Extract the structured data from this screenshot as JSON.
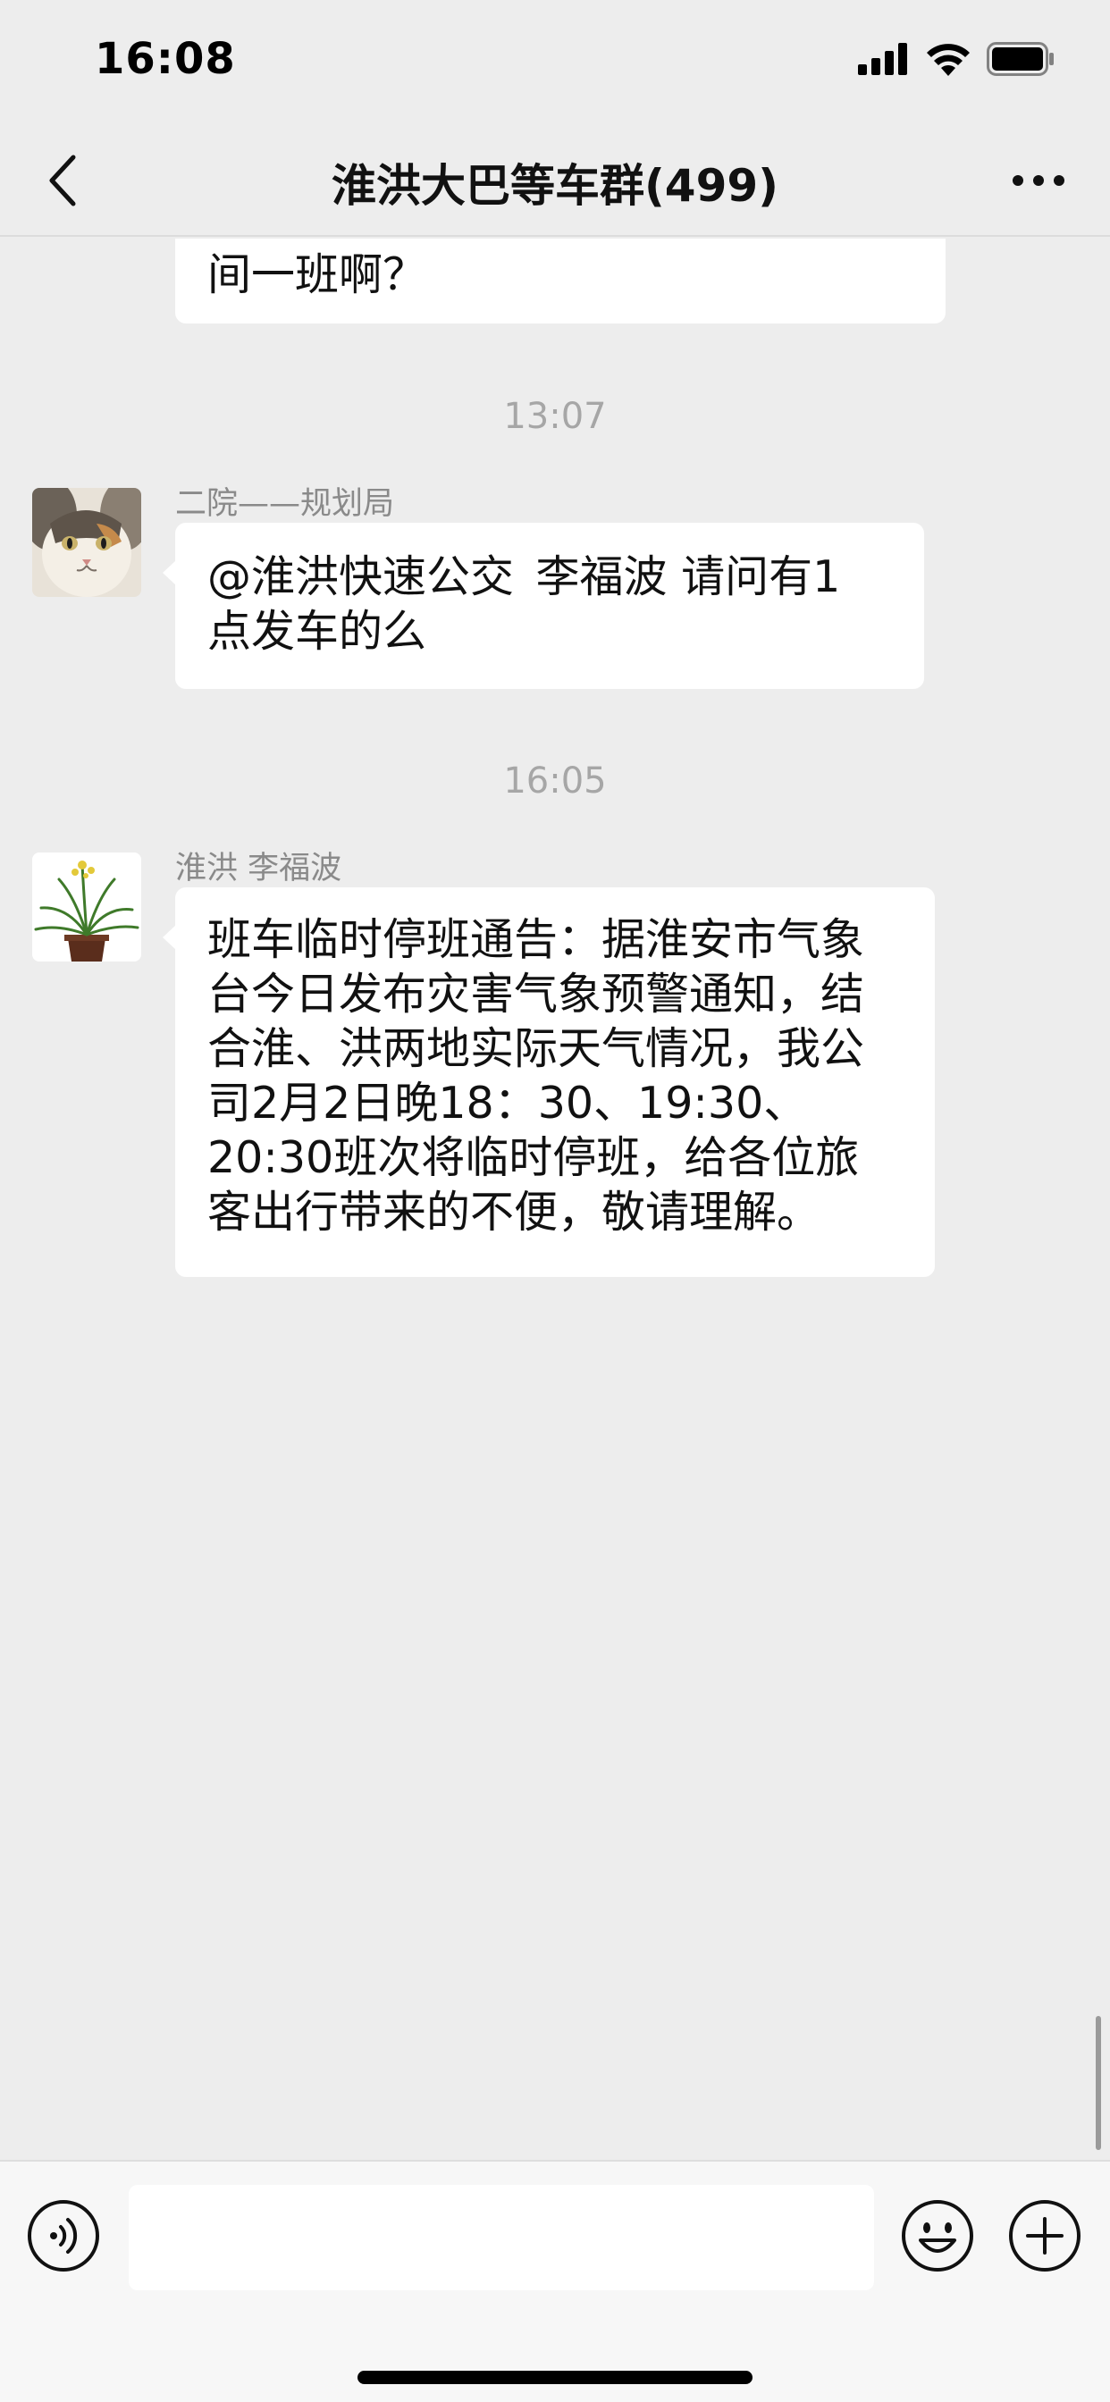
{
  "status_bar": {
    "time": "16:08",
    "icons": [
      "signal-icon",
      "wifi-icon",
      "battery-icon"
    ]
  },
  "nav": {
    "title": "淮洪大巴等车群(499)",
    "back_icon": "chevron-left-icon",
    "more_icon": "more-dots-icon"
  },
  "messages": [
    {
      "type": "text",
      "lines": [
        "间一班啊？"
      ]
    },
    {
      "type": "timestamp",
      "text": "13:07"
    },
    {
      "type": "text",
      "sender": "二院——规划局",
      "avatar": "cat-avatar",
      "lines": [
        "@淮洪快速公交  李福波 请问有1",
        "点发车的么"
      ]
    },
    {
      "type": "timestamp",
      "text": "16:05"
    },
    {
      "type": "text",
      "sender": "淮洪 李福波",
      "avatar": "plant-avatar",
      "lines": [
        "班车临时停班通告：据淮安市气象",
        "台今日发布灾害气象预警通知，结",
        "合淮、洪两地实际天气情况，我公",
        "司2月2日晚18：30、19:30、",
        "20:30班次将临时停班，给各位旅",
        "客出行带来的不便，敬请理解。"
      ]
    }
  ],
  "input_bar": {
    "text_value": "",
    "voice_icon": "voice-icon",
    "emoji_icon": "emoji-icon",
    "plus_icon": "plus-icon"
  },
  "colors": {
    "background": "#ededed",
    "bubble": "#ffffff",
    "timestamp": "#a6a6a6",
    "sender": "#8a8a8a"
  }
}
